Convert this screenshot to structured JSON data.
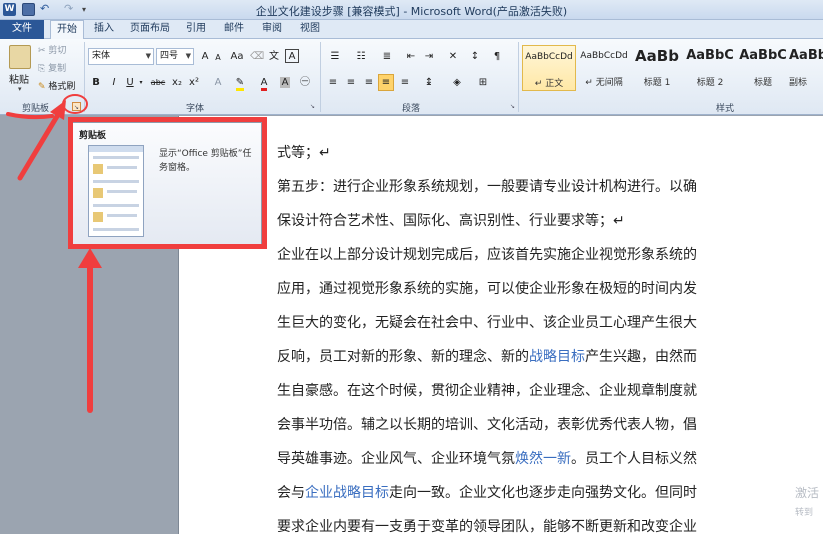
{
  "window": {
    "title": "企业文化建设步骤 [兼容模式] - Microsoft Word(产品激活失败)",
    "app_icon": "W"
  },
  "tabs": [
    {
      "label": "文件"
    },
    {
      "label": "开始"
    },
    {
      "label": "插入"
    },
    {
      "label": "页面布局"
    },
    {
      "label": "引用"
    },
    {
      "label": "邮件"
    },
    {
      "label": "审阅"
    },
    {
      "label": "视图"
    }
  ],
  "ribbon": {
    "clipboard": {
      "paste": "粘贴",
      "cut": "剪切",
      "copy": "复制",
      "format_painter": "格式刷",
      "label": "剪贴板"
    },
    "font": {
      "font_name": "宋体",
      "font_size": "四号",
      "label": "字体",
      "bold": "B",
      "italic": "I",
      "underline": "U",
      "strike": "abc",
      "subscript": "x₂",
      "superscript": "x²",
      "grow": "A",
      "shrink": "A",
      "case": "Aa",
      "char_border": "A"
    },
    "paragraph": {
      "label": "段落"
    },
    "styles": {
      "label": "样式",
      "items": [
        {
          "sample": "AaBbCcDd",
          "name": "↵ 正文"
        },
        {
          "sample": "AaBbCcDd",
          "name": "↵ 无间隔"
        },
        {
          "sample": "AaBb",
          "name": "标题 1"
        },
        {
          "sample": "AaBbC",
          "name": "标题 2"
        },
        {
          "sample": "AaBbC",
          "name": "标题"
        },
        {
          "sample": "AaBbC",
          "name": "副标"
        }
      ]
    }
  },
  "tooltip": {
    "title": "剪贴板",
    "text": "显示“Office 剪贴板”任务窗格。"
  },
  "document": {
    "lines": [
      [
        {
          "t": "式等；↵"
        }
      ],
      [
        {
          "t": "第五步：进行企业形象系统规划，一般要请专业设计机构进行。以确"
        }
      ],
      [
        {
          "t": "保设计符合艺术性、国际化、高识别性、行业要求等；↵"
        }
      ],
      [
        {
          "t": "企业在以上部分设计规划完成后，应该首先实施企业视觉形象系统的"
        }
      ],
      [
        {
          "t": "应用，通过视觉形象系统的实施，可以使企业形象在极短的时间内发"
        }
      ],
      [
        {
          "t": "生巨大的变化，无疑会在社会中、行业中、该企业员工心理产生很大"
        }
      ],
      [
        {
          "t": "反响，员工对新的形象、新的理念、新的"
        },
        {
          "t": "战略目标",
          "link": true
        },
        {
          "t": "产生兴趣，由然而"
        }
      ],
      [
        {
          "t": "生自豪感。在这个时候，贯彻企业精神，企业理念、企业规章制度就"
        }
      ],
      [
        {
          "t": "会事半功倍。辅之以长期的培训、文化活动，表彰优秀代表人物，倡"
        }
      ],
      [
        {
          "t": "导英雄事迹。企业风气、企业环境气氛"
        },
        {
          "t": "焕然一新",
          "link": true
        },
        {
          "t": "。员工个人目标义然"
        }
      ],
      [
        {
          "t": "会与"
        },
        {
          "t": "企业战略目标",
          "link": true
        },
        {
          "t": "走向一致。企业文化也逐步走向强势文化。但同时"
        }
      ],
      [
        {
          "t": "要求企业内要有一支勇于变革的领导团队，能够不断更新和改变企业"
        }
      ]
    ]
  },
  "watermark": {
    "line1": "激活",
    "line2": "转到"
  },
  "colors": {
    "annotation_red": "#f03e3e",
    "link_blue": "#3a6ec0",
    "file_tab": "#2b5797"
  }
}
